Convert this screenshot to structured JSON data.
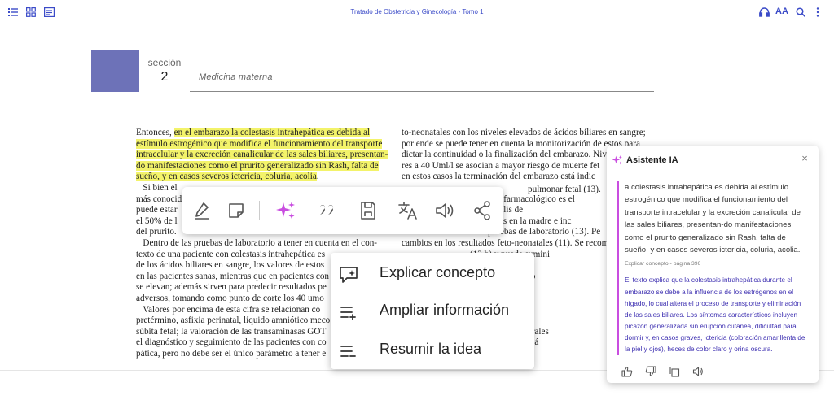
{
  "topbar": {
    "title": "Tratado de Obstetricia y Ginecología - Tomo 1",
    "font_size_label": "AA",
    "icons": [
      "list-icon",
      "grid-icon",
      "book-icon",
      "headphones-icon",
      "font-size-icon",
      "search-icon",
      "more-vert-icon"
    ],
    "accent_color": "#3b4bc8"
  },
  "section": {
    "label": "sección",
    "number": "2",
    "name": "Medicina materna",
    "block_color": "#6d72b8"
  },
  "left_column": [
    {
      "pre": "Entonces, ",
      "hl": "en el embarazo la colestasis intrahepática es debida al",
      "post": ""
    },
    {
      "pre": "",
      "hl": "estímulo estrogénico que modifica el funcionamiento del transporte",
      "post": ""
    },
    {
      "pre": "",
      "hl": "intracelular y la excreción canalicular de las sales biliares, presentan-",
      "post": ""
    },
    {
      "pre": "",
      "hl": "do manifestaciones como el prurito generalizado sin Rash, falta de",
      "post": ""
    },
    {
      "pre": "",
      "hl": "sueño, y en casos severos ictericia, coluria, acolia",
      "post": "."
    },
    {
      "pre": "   Si bien el",
      "hl": "",
      "post": ""
    },
    {
      "pre": "más conocid",
      "hl": "",
      "post": ""
    },
    {
      "pre": "puede estar",
      "hl": "",
      "post": ""
    },
    {
      "pre": "el 50% de l",
      "hl": "",
      "post": ""
    },
    {
      "pre": "del prurito.",
      "hl": "",
      "post": ""
    },
    {
      "pre": "   Dentro de las pruebas de laboratorio a tener en cuenta en el con-",
      "hl": "",
      "post": ""
    },
    {
      "pre": "texto de una paciente con colestasis intrahepática es",
      "hl": "",
      "post": ""
    },
    {
      "pre": "de los ácidos biliares en sangre, los valores de estos",
      "hl": "",
      "post": ""
    },
    {
      "pre": "en las pacientes sanas, mientras que en pacientes con",
      "hl": "",
      "post": ""
    },
    {
      "pre": "se elevan; además sirven para predecir resultados pe",
      "hl": "",
      "post": ""
    },
    {
      "pre": "adversos, tomando como punto de corte los 40 umo",
      "hl": "",
      "post": ""
    },
    {
      "pre": "   Valores por encima de esta cifra se relacionan co",
      "hl": "",
      "post": ""
    },
    {
      "pre": "pretérmino, asfixia perinatal, líquido amniótico meco",
      "hl": "",
      "post": ""
    },
    {
      "pre": "súbita fetal; la valoración de las transaminasas GOT",
      "hl": "",
      "post": ""
    },
    {
      "pre": "el diagnóstico y seguimiento de las pacientes con co",
      "hl": "",
      "post": ""
    },
    {
      "pre": "pática, pero no debe ser el único parámetro a tener e",
      "hl": "",
      "post": ""
    }
  ],
  "right_column": [
    "to-neonatales con los niveles elevados de ácidos biliares en sangre;",
    "por ende se puede tener en cuenta la monitorización de estos para",
    "dictar la continuidad o la finalización del embarazo. Niv",
    "res a 40 Uml/l se asocian a mayor riesgo de muerte fet",
    "en estos casos la terminación del embarazo está indic",
    "",
    "                                manejo farmacológico es el",
    "                                 en la bilis de",
    "                                síntomas en la madre e inc",
    "en los resultados de las pruebas de laboratorio (13). Pe",
    "cambios en los resultados feto-neonatales (11). Se recom",
    "                              (12 h) y puede sumini",
    "                              pacientes de",
    "                             recibieron altos do",
    "                             con el uso de la d",
    "                             fenobarbital, c",
    "                             uestran resultados",
    "                             resultados de la",
    "                             anticonceptivos orales",
    "                             colestasis intrahepá",
    ""
  ],
  "right_column_fragment": "pulmonar fetal (13).",
  "toolbar": {
    "tools": [
      "highlighter-icon",
      "note-icon",
      "ai-sparkle-icon",
      "quote-icon",
      "save-icon",
      "translate-icon",
      "audio-icon",
      "share-icon"
    ]
  },
  "context_menu": {
    "items": [
      {
        "label": "Explicar concepto",
        "icon": "chat-explain-icon"
      },
      {
        "label": "Ampliar información",
        "icon": "list-add-icon"
      },
      {
        "label": "Resumir la idea",
        "icon": "list-summary-icon"
      }
    ]
  },
  "ai_panel": {
    "title": "Asistente IA",
    "close_label": "×",
    "quote": "a colestasis intrahepática es debida al estímulo estrogénico que modifica el funcionamiento del transporte intracelular y la excreción canalicular de las sales biliares, presentan-do manifestaciones como el prurito generalizado sin Rash, falta de sueño, y en casos severos ictericia, coluria, acolia.",
    "source": "Explicar concepto - página 396",
    "answer": "El texto explica que la colestasis intrahepática durante el embarazo se debe a la influencia de los estrógenos en el hígado, lo cual altera el proceso de transporte y eliminación de las sales biliares. Los síntomas característicos incluyen picazón generalizada sin erupción cutánea, dificultad para dormir y, en casos graves, ictericia (coloración amarillenta de la piel y ojos), heces de color claro y orina oscura.",
    "quote_bar_color": "#c94ee0",
    "answer_color": "#3b2db0",
    "actions": [
      "thumbs-up-icon",
      "thumbs-down-icon",
      "copy-icon",
      "speaker-icon"
    ]
  }
}
